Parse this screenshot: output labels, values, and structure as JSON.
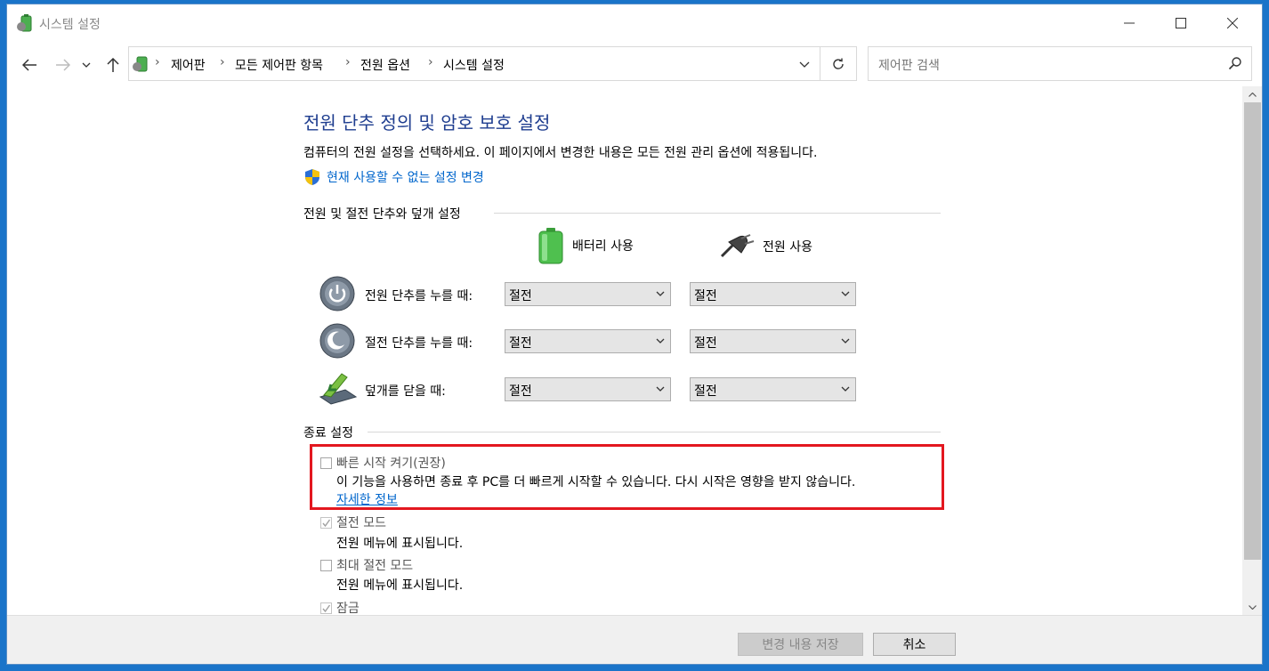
{
  "window": {
    "title": "시스템 설정"
  },
  "nav": {
    "breadcrumbs": [
      "제어판",
      "모든 제어판 항목",
      "전원 옵션",
      "시스템 설정"
    ],
    "search_placeholder": "제어판 검색"
  },
  "page": {
    "heading": "전원 단추 정의 및 암호 보호 설정",
    "description": "컴퓨터의 전원 설정을 선택하세요. 이 페이지에서 변경한 내용은 모든 전원 관리 옵션에 적용됩니다.",
    "uac_link": "현재 사용할 수 없는 설정 변경",
    "section_buttons": "전원 및 절전 단추와 덮개 설정",
    "col_battery": "배터리 사용",
    "col_plugged": "전원 사용",
    "rows": [
      {
        "label": "전원 단추를 누를 때:",
        "battery": "절전",
        "plugged": "절전"
      },
      {
        "label": "절전 단추를 누를 때:",
        "battery": "절전",
        "plugged": "절전"
      },
      {
        "label": "덮개를 닫을 때:",
        "battery": "절전",
        "plugged": "절전"
      }
    ],
    "section_shutdown": "종료 설정",
    "options": [
      {
        "title": "빠른 시작 켜기(권장)",
        "desc": "이 기능을 사용하면 종료 후 PC를 더 빠르게 시작할 수 있습니다. 다시 시작은 영향을 받지 않습니다.",
        "link": "자세한 정보",
        "checked": false
      },
      {
        "title": "절전 모드",
        "desc": "전원 메뉴에 표시됩니다.",
        "checked": true
      },
      {
        "title": "최대 절전 모드",
        "desc": "전원 메뉴에 표시됩니다.",
        "checked": false
      },
      {
        "title": "잠금",
        "checked": true
      }
    ]
  },
  "footer": {
    "save_label": "변경 내용 저장",
    "cancel_label": "취소"
  },
  "colors": {
    "highlight": "#e3171f",
    "heading": "#1e3d8f",
    "link": "#0066cc"
  }
}
